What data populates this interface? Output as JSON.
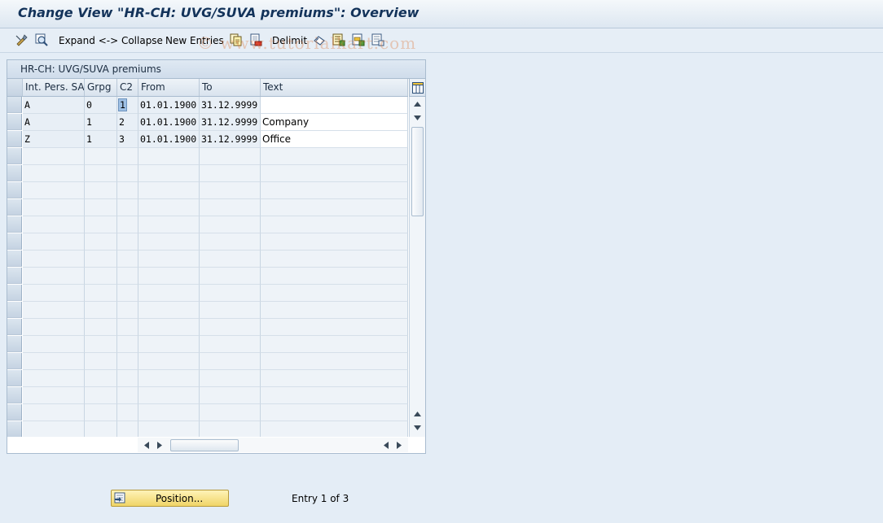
{
  "window": {
    "title": "Change View \"HR-CH: UVG/SUVA premiums\": Overview"
  },
  "toolbar": {
    "expand_collapse": "Expand <-> Collapse",
    "new_entries": "New Entries",
    "delimit": "Delimit",
    "icons": [
      "display-change-icon",
      "details-icon",
      "copy-icon",
      "delete-icon",
      "undo-icon",
      "select-all-icon",
      "select-block-icon",
      "deselect-all-icon"
    ]
  },
  "watermark": "© www.tutorialkart.com",
  "table": {
    "title": "HR-CH: UVG/SUVA premiums",
    "columns": [
      "Int. Pers. SA",
      "Grpg",
      "C2",
      "From",
      "To",
      "Text"
    ],
    "rows": [
      {
        "sa": "A",
        "grpg": "0",
        "c2": "1",
        "from": "01.01.1900",
        "to": "31.12.9999",
        "text": ""
      },
      {
        "sa": "A",
        "grpg": "1",
        "c2": "2",
        "from": "01.01.1900",
        "to": "31.12.9999",
        "text": "Company"
      },
      {
        "sa": "Z",
        "grpg": "1",
        "c2": "3",
        "from": "01.01.1900",
        "to": "31.12.9999",
        "text": "Office"
      }
    ]
  },
  "footer": {
    "position_button": "Position...",
    "entry_info": "Entry 1 of 3"
  },
  "colors": {
    "title_text": "#13335a",
    "button_yellow": "#f0d567",
    "background": "#e4edf6"
  }
}
